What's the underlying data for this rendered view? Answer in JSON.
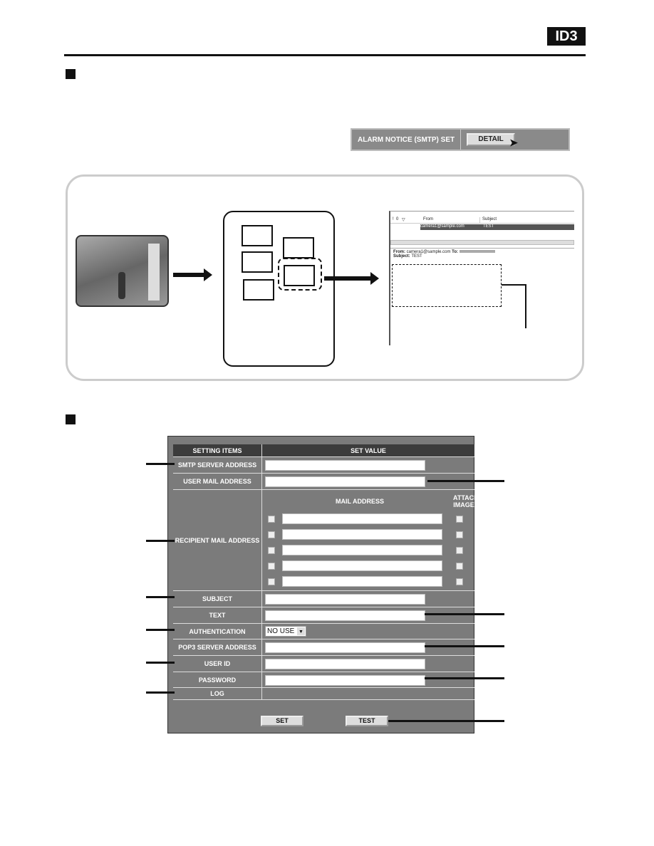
{
  "header": {
    "badge": "ID3"
  },
  "detail_bar": {
    "label": "ALARM NOTICE (SMTP) SET",
    "button": "DETAIL"
  },
  "mail_client": {
    "columns": [
      "!",
      "0",
      "▽",
      "From",
      "Subject"
    ],
    "message": {
      "from": "camera1@sample.com",
      "subject": "TEST"
    },
    "preview_from_label": "From:",
    "preview_from": "camera1@sample.com",
    "preview_to_label": "To:",
    "preview_subject_label": "Subject:",
    "preview_subject": "TEST"
  },
  "form": {
    "header_items": "SETTING ITEMS",
    "header_value": "SET VALUE",
    "rows": {
      "smtp": "SMTP SERVER ADDRESS",
      "user_mail": "USER MAIL ADDRESS",
      "recipient": "RECIPIENT MAIL ADDRESS",
      "subject": "SUBJECT",
      "text": "TEXT",
      "auth": "AUTHENTICATION",
      "pop3": "POP3 SERVER ADDRESS",
      "user_id": "USER ID",
      "password": "PASSWORD",
      "log": "LOG"
    },
    "mail_address_header": "MAIL ADDRESS",
    "attach_header_1": "ATTACH",
    "attach_header_2": "IMAGE",
    "auth_value": "NO USE",
    "set_button": "SET",
    "test_button": "TEST"
  }
}
